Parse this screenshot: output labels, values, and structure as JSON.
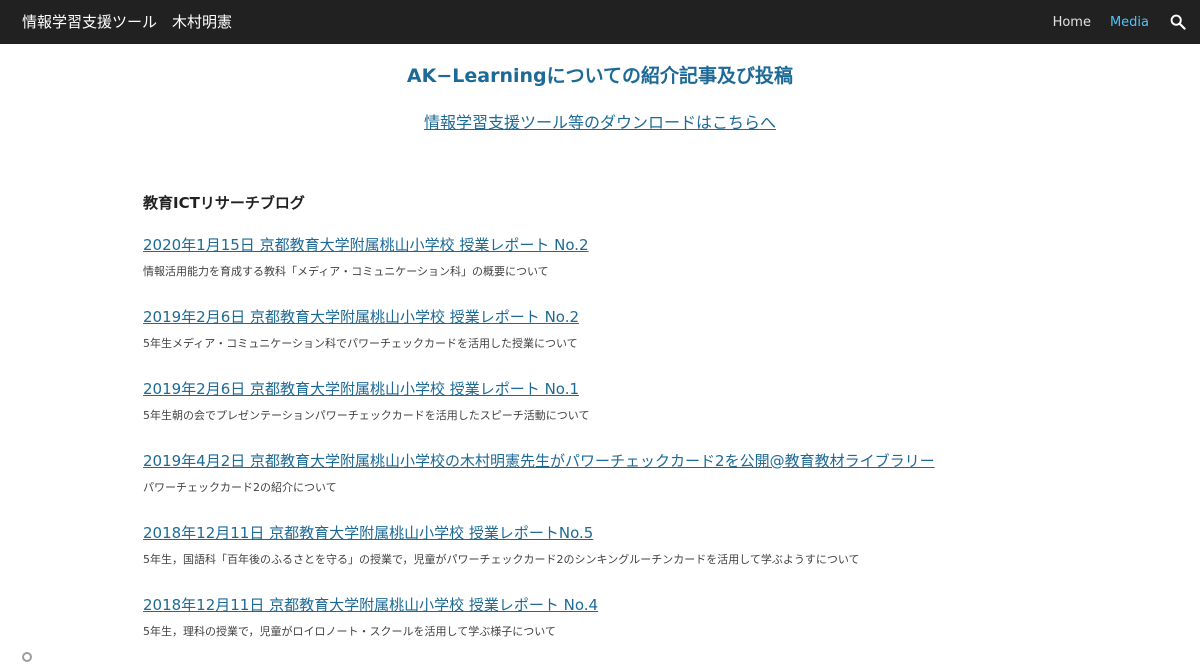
{
  "header": {
    "site_title": "情報学習支援ツール　木村明憲",
    "nav": [
      {
        "label": "Home",
        "active": false
      },
      {
        "label": "Media",
        "active": true
      }
    ],
    "search_icon": "search-icon"
  },
  "main": {
    "heading": "AK−Learningについての紹介記事及び投稿",
    "download_link": "情報学習支援ツール等のダウンロードはこちらへ",
    "blog": {
      "title": "教育ICTリサーチブログ",
      "posts": [
        {
          "title": "2020年1月15日 京都教育大学附属桃山小学校 授業レポート No.2",
          "description": "情報活用能力を育成する教科「メディア・コミュニケーション科」の概要について"
        },
        {
          "title": "2019年2月6日 京都教育大学附属桃山小学校 授業レポート No.2",
          "description": "5年生メディア・コミュニケーション科でパワーチェックカードを活用した授業について"
        },
        {
          "title": "2019年2月6日 京都教育大学附属桃山小学校 授業レポート No.1",
          "description": "5年生朝の会でプレゼンテーションパワーチェックカードを活用したスピーチ活動について"
        },
        {
          "title": "2019年4月2日 京都教育大学附属桃山小学校の木村明憲先生がパワーチェックカード2を公開@教育教材ライブラリー",
          "description": "パワーチェックカード2の紹介について"
        },
        {
          "title": "2018年12月11日 京都教育大学附属桃山小学校 授業レポートNo.5",
          "description": "5年生，国語科「百年後のふるさとを守る」の授業で，児童がパワーチェックカード2のシンキングルーチンカードを活用して学ぶようすについて"
        },
        {
          "title": "2018年12月11日 京都教育大学附属桃山小学校 授業レポート No.4",
          "description": "5年生，理科の授業で，児童がロイロノート・スクールを活用して学ぶ様子について"
        }
      ]
    }
  },
  "colors": {
    "topbar": "#212121",
    "accent": "#1d6a96",
    "nav_active": "#4fc3f7"
  }
}
